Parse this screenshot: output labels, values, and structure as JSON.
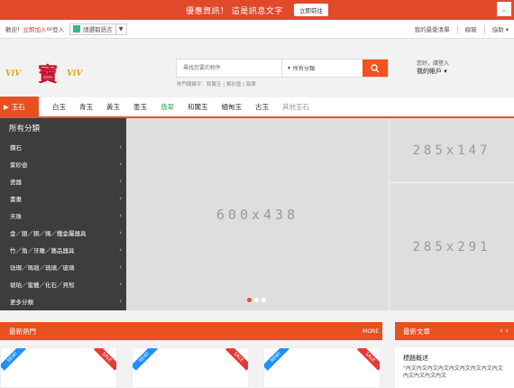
{
  "promo": {
    "text": "優惠資訊！ 這是訊息文字",
    "button": "立即前往",
    "close": "⌄"
  },
  "topbar": {
    "welcome": "歡迎！",
    "join": "立即加入",
    "or": " or ",
    "login": "登入",
    "lang": "請選取語言",
    "lang_arrow": "▼",
    "links": [
      "我的最愛清單",
      "線報",
      "協助 ▾"
    ]
  },
  "logo": {
    "left": "ViV",
    "char": "寶",
    "right": "ViV"
  },
  "search": {
    "placeholder": "尋找您要的物件",
    "category": "所有分類",
    "hot_label": "熱門關鍵字：",
    "hot": "和闐玉 | 紫砂壺 | 翡翠"
  },
  "account": {
    "greet": "您好，請登入",
    "label": "我的帳戶 ▾"
  },
  "catnav": {
    "current": "玉石",
    "items": [
      "白玉",
      "青玉",
      "黃玉",
      "墨玉",
      "翡翠",
      "和闐玉",
      "緬甸玉",
      "古玉",
      "其他玉石"
    ],
    "accent": "#e8501f",
    "jade_color": "#3aa04a"
  },
  "sidebar": {
    "header": "所有分類",
    "items": [
      "鑽石",
      "紫砂壺",
      "瓷器",
      "書畫",
      "天珠",
      "金／銀／銅／錫／鐵金屬器具",
      "竹／角／牙雕／藝品器具",
      "琺瑯／瑪瑙／琉璃／玻璃",
      "琥珀／蜜蠟／化石／貝殼",
      "更多分類"
    ],
    "arrow": "›"
  },
  "banner": {
    "main": "600x438",
    "side_top": "285x147",
    "side_bottom": "285x291"
  },
  "sections": {
    "hot": "最新熱門",
    "more": "MORE",
    "articles": "最新文章",
    "nav": "‹ ›"
  },
  "badges": {
    "new": "NEW!",
    "sale": "SALE"
  },
  "news": {
    "title": "標題概述",
    "text": "\"內文內文內文內文內文內文內文內文內文內文內文內文內文"
  }
}
